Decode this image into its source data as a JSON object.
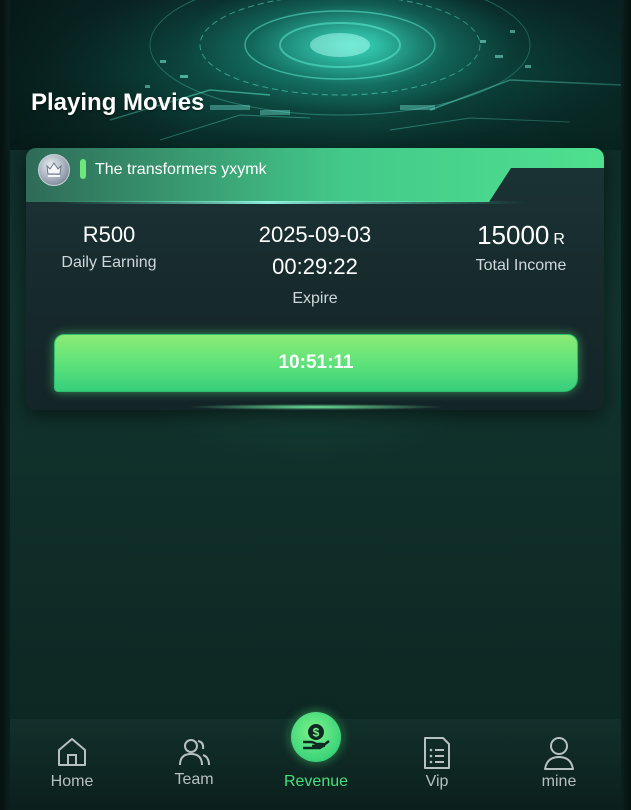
{
  "page": {
    "title": "Playing Movies"
  },
  "product": {
    "name": "The transformers yxymk",
    "daily_earning_value": "R500",
    "daily_earning_label": "Daily Earning",
    "expire_date": "2025-09-03",
    "expire_time": "00:29:22",
    "expire_label": "Expire",
    "total_income_value": "15000",
    "total_income_unit": "R",
    "total_income_label": "Total Income",
    "countdown": "10:51:11",
    "badge_icon": "crown-shield-icon"
  },
  "nav": {
    "items": [
      {
        "label": "Home",
        "icon": "home-icon",
        "active": false
      },
      {
        "label": "Team",
        "icon": "team-icon",
        "active": false
      },
      {
        "label": "Revenue",
        "icon": "money-hand-icon",
        "active": true
      },
      {
        "label": "Vip",
        "icon": "document-list-icon",
        "active": false
      },
      {
        "label": "mine",
        "icon": "user-icon",
        "active": false
      }
    ]
  },
  "colors": {
    "accent_green": "#47e07d",
    "button_gradient_top": "#8ceb75",
    "button_gradient_bottom": "#37cf7c",
    "card_bg": "#1c3436",
    "background": "#12352f"
  }
}
